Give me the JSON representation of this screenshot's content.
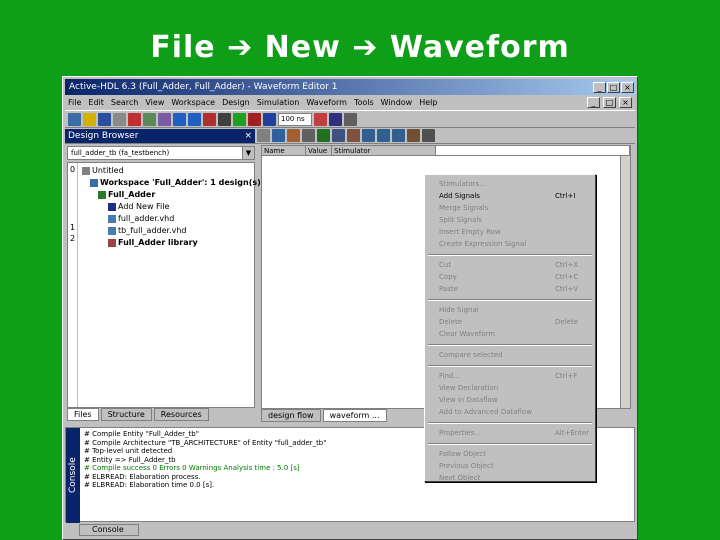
{
  "slide": {
    "title": "File ➔ New ➔ Waveform"
  },
  "window": {
    "title": "Active-HDL 6.3 (Full_Adder, Full_Adder) - Waveform Editor 1",
    "menu": [
      "File",
      "Edit",
      "Search",
      "View",
      "Workspace",
      "Design",
      "Simulation",
      "Waveform",
      "Tools",
      "Window",
      "Help"
    ],
    "zoom": "100 ns"
  },
  "browser": {
    "title": "Design Browser",
    "combo": "full_adder_tb (fa_testbench)",
    "tree": [
      {
        "label": "Untitled",
        "indent": 0
      },
      {
        "label": "Workspace 'Full_Adder': 1 design(s)",
        "indent": 1
      },
      {
        "label": "Full_Adder",
        "indent": 2
      },
      {
        "label": "Add New File",
        "indent": 3
      },
      {
        "label": "full_adder.vhd",
        "indent": 3
      },
      {
        "label": "tb_full_adder.vhd",
        "indent": 3
      },
      {
        "label": "Full_Adder library",
        "indent": 3
      }
    ],
    "gutter": [
      "0",
      "1",
      "2"
    ],
    "tabs": [
      "Files",
      "Structure",
      "Resources"
    ]
  },
  "waveform": {
    "headers": [
      "Name",
      "Value",
      "Stimulator"
    ],
    "tabs": [
      "design flow",
      "waveform ..."
    ]
  },
  "context_menu": [
    {
      "label": "Stimulators...",
      "key": "",
      "on": false
    },
    {
      "label": "Add Signals",
      "key": "Ctrl+I",
      "on": true
    },
    {
      "label": "Merge Signals",
      "key": "",
      "on": false
    },
    {
      "label": "Split Signals",
      "key": "",
      "on": false
    },
    {
      "label": "Insert Empty Row",
      "key": "",
      "on": false
    },
    {
      "label": "Create Expression Signal",
      "key": "",
      "on": false
    },
    {
      "sep": true
    },
    {
      "label": "Cut",
      "key": "Ctrl+X",
      "on": false
    },
    {
      "label": "Copy",
      "key": "Ctrl+C",
      "on": false
    },
    {
      "label": "Paste",
      "key": "Ctrl+V",
      "on": false
    },
    {
      "sep": true
    },
    {
      "label": "Hide Signal",
      "key": "",
      "on": false
    },
    {
      "label": "Delete",
      "key": "Delete",
      "on": false
    },
    {
      "label": "Clear Waveform",
      "key": "",
      "on": false
    },
    {
      "sep": true
    },
    {
      "label": "Compare selected",
      "key": "",
      "on": false
    },
    {
      "sep": true
    },
    {
      "label": "Find...",
      "key": "Ctrl+F",
      "on": false
    },
    {
      "label": "View Declaration",
      "key": "",
      "on": false
    },
    {
      "label": "View in Dataflow",
      "key": "",
      "on": false
    },
    {
      "label": "Add to Advanced Dataflow",
      "key": "",
      "on": false
    },
    {
      "sep": true
    },
    {
      "label": "Properties...",
      "key": "Alt+Enter",
      "on": false
    },
    {
      "sep": true
    },
    {
      "label": "Follow Object",
      "key": "",
      "on": false
    },
    {
      "label": "Previous Object",
      "key": "",
      "on": false
    },
    {
      "label": "Next Object",
      "key": "",
      "on": false
    }
  ],
  "console": {
    "label": "Console",
    "tab": "Console",
    "lines": [
      "# Compile Entity \"Full_Adder_tb\"",
      "# Compile Architecture \"TB_ARCHITECTURE\" of Entity \"full_adder_tb\"",
      "# Top-level unit detected",
      "# Entity => Full_Adder_tb",
      "# Compile success 0 Errors 0 Warnings  Analysis time :  5.0 [s]",
      "# ELBREAD: Elaboration process.",
      "# ELBREAD: Elaboration time 0.0 [s]."
    ]
  },
  "colors": {
    "slide_bg": "#0f9e18",
    "titlebar": "#0a246a",
    "console_green": "#007a00"
  }
}
